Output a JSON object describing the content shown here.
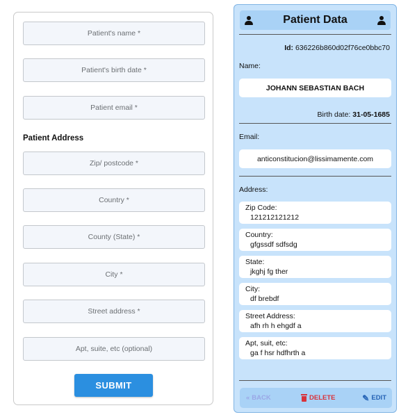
{
  "form": {
    "fields": {
      "name": "Patient's name *",
      "birth": "Patient's birth date *",
      "email": "Patient email *",
      "zip": "Zip/ postcode *",
      "country": "Country *",
      "county": "County (State) *",
      "city": "City *",
      "street": "Street address *",
      "apt": "Apt, suite, etc (optional)"
    },
    "address_section": "Patient Address",
    "submit_label": "SUBMIT"
  },
  "panel": {
    "title": "Patient Data",
    "id_label": "Id:",
    "id_value": "636226b860d02f76ce0bbc70",
    "name_label": "Name:",
    "name_value": "JOHANN SEBASTIAN BACH",
    "birth_label": "Birth date:",
    "birth_value": "31-05-1685",
    "email_label": "Email:",
    "email_value": "anticonstitucion@lissimamente.com",
    "address_label": "Address:",
    "address": {
      "zip_label": "Zip Code:",
      "zip_value": "121212121212",
      "country_label": "Country:",
      "country_value": "gfgssdf sdfsdg",
      "state_label": "State:",
      "state_value": "jkghj fg ther",
      "city_label": "City:",
      "city_value": "df brebdf",
      "street_label": "Street Address:",
      "street_value": "afh rh h ehgdf a",
      "apt_label": "Apt, suit, etc:",
      "apt_value": "ga f hsr hdfhrth a"
    },
    "footer": {
      "back_icon": "«",
      "back_label": "BACK",
      "delete_label": "DELETE",
      "edit_icon": "✎",
      "edit_label": "EDIT"
    }
  },
  "colors": {
    "submit": "#2b8fe0",
    "panel_bg": "#c8e3fb",
    "panel_header": "#a9d2f6",
    "delete": "#d8333b",
    "edit": "#2563b5",
    "back_disabled": "#9aa7e6"
  },
  "icons": {
    "header_left": "user-icon",
    "header_right": "user-icon",
    "back": "double-chevron-left-icon",
    "delete": "trash-icon",
    "edit": "pencil-icon"
  }
}
